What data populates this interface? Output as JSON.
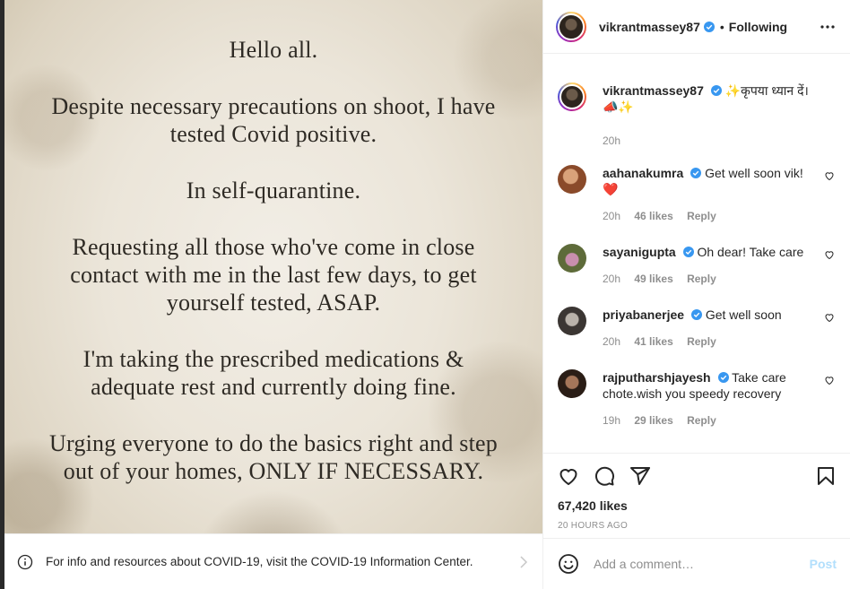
{
  "post": {
    "lines": [
      "Hello all.",
      "Despite necessary precautions on shoot, I have\ntested Covid positive.",
      "In self-quarantine.",
      "Requesting all those who've come in close\ncontact with me in the last few days, to get\nyourself tested, ASAP.",
      "I'm taking the prescribed medications &\nadequate rest and currently doing fine.",
      "Urging everyone to do the basics right and step\nout of your homes, ONLY IF NECESSARY."
    ]
  },
  "covid_bar": {
    "text": "For info and resources about COVID-19, visit the COVID-19 Information Center."
  },
  "header": {
    "username": "vikrantmassey87",
    "separator": "•",
    "follow_label": "Following"
  },
  "caption": {
    "username": "vikrantmassey87",
    "text": "✨कृपया ध्यान दें।📣✨",
    "time": "20h"
  },
  "comments": [
    {
      "username": "aahanakumra",
      "text": "Get well soon vik! ❤️",
      "time": "20h",
      "likes": "46 likes",
      "reply": "Reply"
    },
    {
      "username": "sayanigupta",
      "text": "Oh dear! Take care",
      "time": "20h",
      "likes": "49 likes",
      "reply": "Reply"
    },
    {
      "username": "priyabanerjee",
      "text": "Get well soon",
      "time": "20h",
      "likes": "41 likes",
      "reply": "Reply"
    },
    {
      "username": "rajputharshjayesh",
      "text": "Take care chote.wish you speedy recovery",
      "time": "19h",
      "likes": "29 likes",
      "reply": "Reply"
    }
  ],
  "actions": {
    "likes": "67,420 likes",
    "time_ago": "20 HOURS AGO"
  },
  "add_comment": {
    "placeholder": "Add a comment…",
    "post_label": "Post"
  },
  "colors": {
    "verified": "#3897f0",
    "link_disabled": "#b2dffc",
    "meta": "#8e8e8e"
  }
}
